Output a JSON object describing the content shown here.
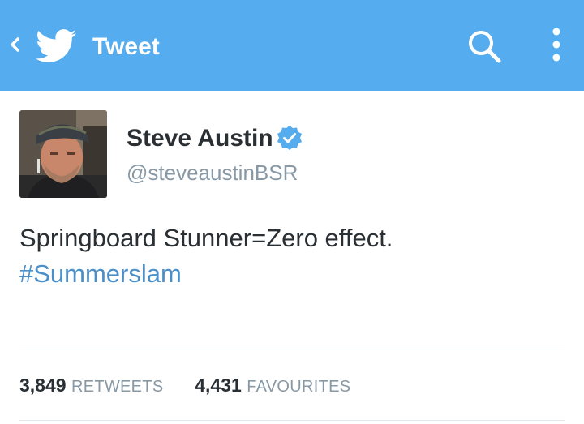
{
  "appbar": {
    "title": "Tweet",
    "background_color": "#55acee",
    "icons": [
      "back-arrow-icon",
      "twitter-bird-icon",
      "search-icon",
      "overflow-menu-icon"
    ]
  },
  "tweet": {
    "author": {
      "name": "Steve Austin",
      "handle": "@steveaustinBSR",
      "verified": true
    },
    "text": "Springboard Stunner=Zero effect.",
    "hashtag": "#Summerslam",
    "stats": {
      "retweets_count": "3,849",
      "retweets_label": "RETWEETS",
      "favourites_count": "4,431",
      "favourites_label": "FAVOURITES"
    }
  }
}
